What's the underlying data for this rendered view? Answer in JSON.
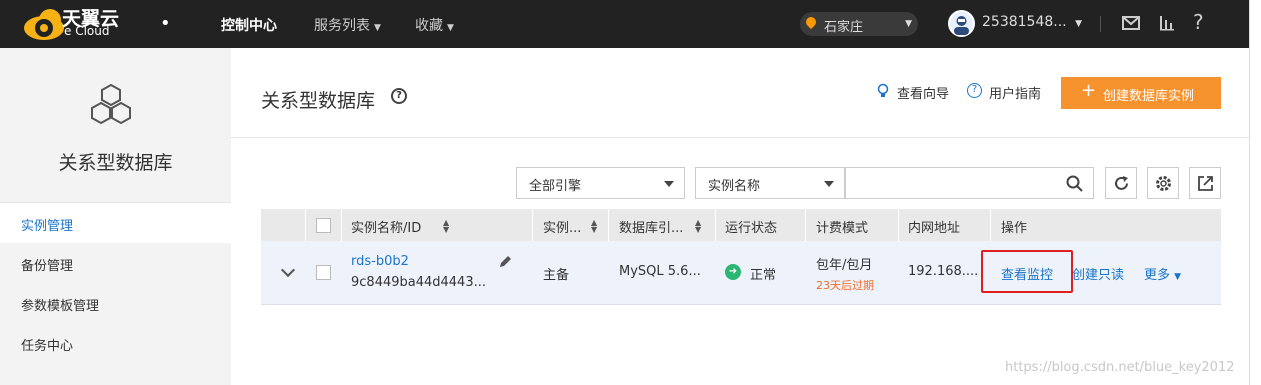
{
  "brand": {
    "name_cn": "天翼云",
    "name_en": "e Cloud"
  },
  "topnav": {
    "items": [
      {
        "label": "控制中心"
      },
      {
        "label": "服务列表"
      },
      {
        "label": "收藏"
      }
    ],
    "region": "石家庄",
    "user": "25381548...",
    "icons": [
      "mail-icon",
      "chart-bars-icon",
      "help-icon"
    ]
  },
  "sidebar": {
    "title": "关系型数据库",
    "items": [
      {
        "label": "实例管理"
      },
      {
        "label": "备份管理"
      },
      {
        "label": "参数模板管理"
      },
      {
        "label": "任务中心"
      }
    ]
  },
  "header": {
    "title": "关系型数据库",
    "guide": "查看向导",
    "user_guide": "用户指南",
    "create_button": "创建数据库实例"
  },
  "filters": {
    "engine_select": "全部引擎",
    "field_select": "实例名称",
    "search_value": ""
  },
  "table": {
    "columns": [
      "实例名称/ID",
      "实例...",
      "数据库引...",
      "运行状态",
      "计费模式",
      "内网地址",
      "操作"
    ],
    "rows": [
      {
        "name": "rds-b0b2",
        "id": "9c8449ba44d4443...",
        "type": "主备",
        "engine": "MySQL 5.6...",
        "status": "正常",
        "billing": "包年/包月",
        "expire": "23天后过期",
        "ip": "192.168....",
        "actions": {
          "monitor": "查看监控",
          "readonly": "创建只读",
          "more": "更多"
        }
      }
    ]
  },
  "watermark": "https://blog.csdn.net/blue_key2012",
  "colors": {
    "accent": "#1a73c8",
    "orange": "#f7932e",
    "highlight": "#e02020",
    "ok": "#2bb673"
  }
}
